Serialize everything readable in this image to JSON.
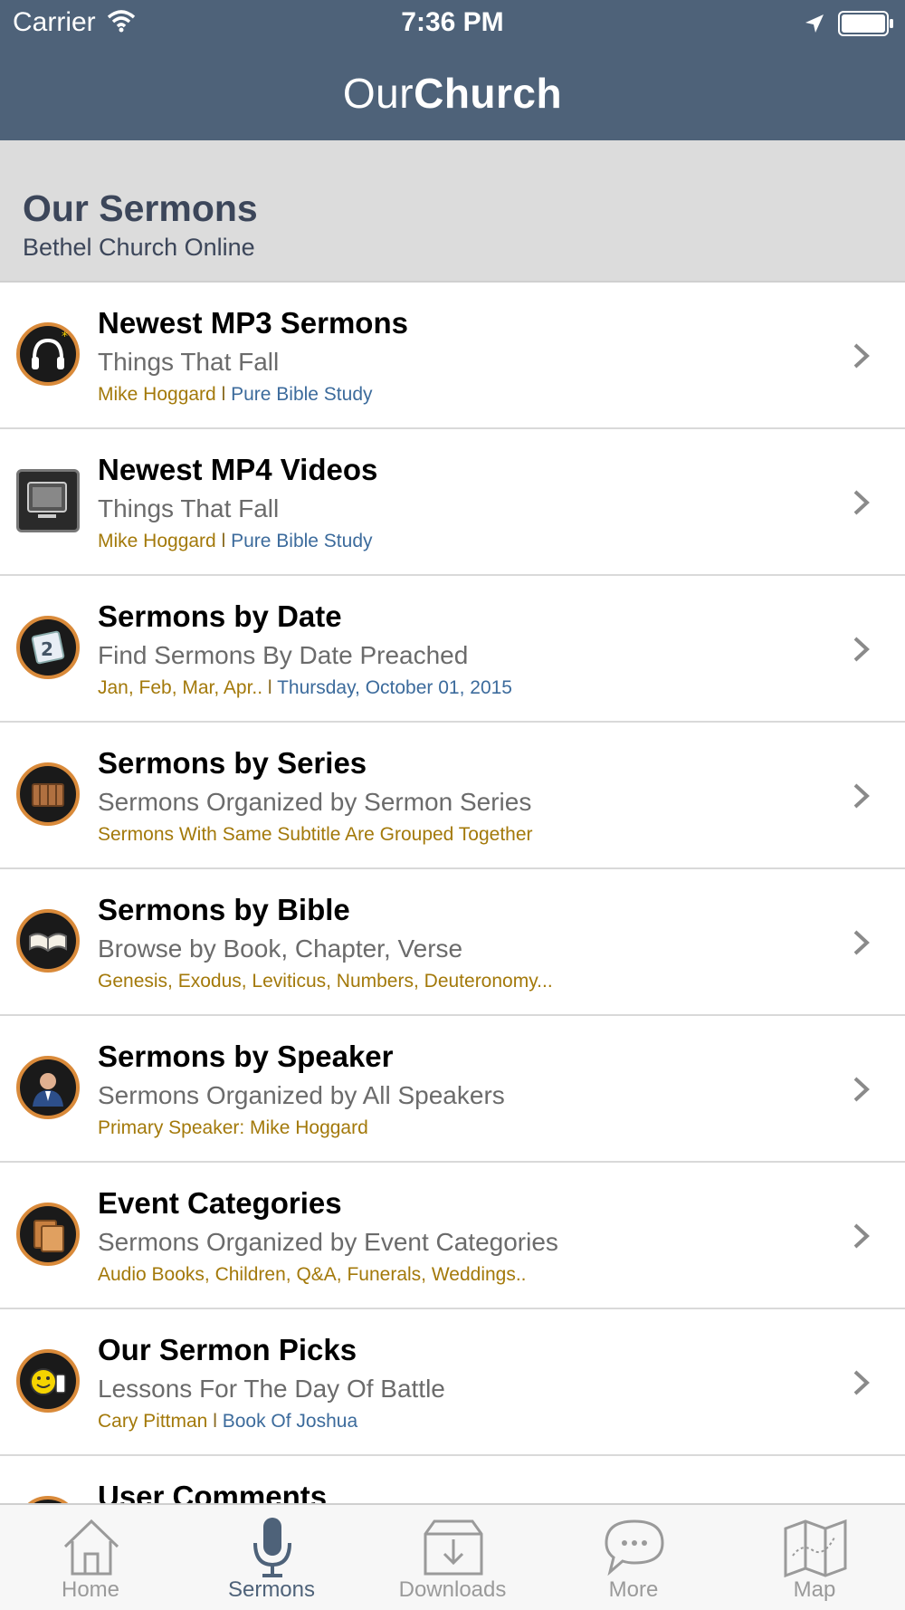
{
  "status_bar": {
    "carrier": "Carrier",
    "time": "7:36 PM"
  },
  "header": {
    "title_light": "Our",
    "title_bold": "Church"
  },
  "section": {
    "title": "Our Sermons",
    "subtitle": "Bethel Church Online"
  },
  "colors": {
    "nav_bar": "#4e6279",
    "meta_gold": "#a3790a",
    "meta_blue": "#3c6b9c",
    "icon_ring": "#d98a3a"
  },
  "list": [
    {
      "title": "Newest MP3 Sermons",
      "sub": "Things That Fall",
      "meta_a": "Mike Hoggard",
      "meta_sep": " l ",
      "meta_b": "Pure Bible Study",
      "icon": "headphones-icon"
    },
    {
      "title": "Newest MP4 Videos",
      "sub": "Things That Fall",
      "meta_a": "Mike Hoggard",
      "meta_sep": " l ",
      "meta_b": "Pure Bible Study",
      "icon": "tv-icon"
    },
    {
      "title": "Sermons by Date",
      "sub": "Find Sermons By Date Preached",
      "meta_a": "Jan, Feb, Mar, Apr..",
      "meta_sep": " l ",
      "meta_b": "Thursday, October 01, 2015",
      "icon": "calendar-icon"
    },
    {
      "title": "Sermons by Series",
      "sub": "Sermons Organized by Sermon Series",
      "meta_a": "Sermons With Same Subtitle Are Grouped Together",
      "meta_sep": "",
      "meta_b": "",
      "icon": "books-icon"
    },
    {
      "title": "Sermons by Bible",
      "sub": "Browse by Book, Chapter, Verse",
      "meta_a": "Genesis, Exodus, Leviticus, Numbers, Deuteronomy...",
      "meta_sep": "",
      "meta_b": "",
      "icon": "bible-icon"
    },
    {
      "title": "Sermons by Speaker",
      "sub": "Sermons Organized by All Speakers",
      "meta_a": "Primary Speaker: Mike Hoggard",
      "meta_sep": "",
      "meta_b": "",
      "icon": "speaker-person-icon"
    },
    {
      "title": "Event Categories",
      "sub": "Sermons Organized by Event Categories",
      "meta_a": "Audio Books, Children, Q&A, Funerals, Weddings..",
      "meta_sep": "",
      "meta_b": "",
      "icon": "folder-icon"
    },
    {
      "title": "Our Sermon Picks",
      "sub": "Lessons For The Day Of Battle",
      "meta_a": "Cary Pittman",
      "meta_sep": " l ",
      "meta_b": "Book Of Joshua",
      "icon": "thumbs-up-smiley-icon"
    },
    {
      "title": "User Comments",
      "sub": "",
      "meta_a": "",
      "meta_sep": "",
      "meta_b": "",
      "icon": "comments-icon"
    }
  ],
  "tabs": [
    {
      "label": "Home",
      "icon": "home-icon",
      "active": false
    },
    {
      "label": "Sermons",
      "icon": "microphone-icon",
      "active": true
    },
    {
      "label": "Downloads",
      "icon": "download-tray-icon",
      "active": false
    },
    {
      "label": "More",
      "icon": "speech-bubble-icon",
      "active": false
    },
    {
      "label": "Map",
      "icon": "map-icon",
      "active": false
    }
  ]
}
